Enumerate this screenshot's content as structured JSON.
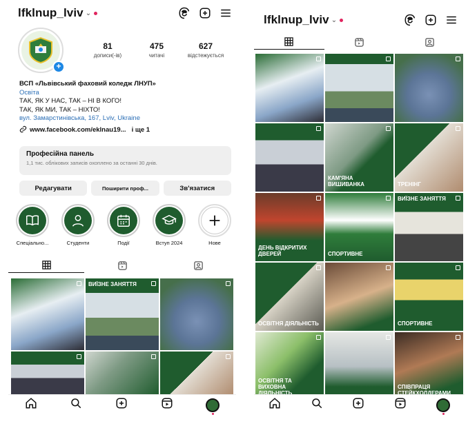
{
  "left": {
    "username": "lfklnup_lviv",
    "stats": [
      {
        "num": "81",
        "label": "дописи(-ів)"
      },
      {
        "num": "475",
        "label": "читачі"
      },
      {
        "num": "627",
        "label": "відстежується"
      }
    ],
    "bio": {
      "name": "ВСП «Львівський фаховий коледж ЛНУП»",
      "category": "Освіта",
      "line1": "ТАК, ЯК У НАС, ТАК – НІ В КОГО!",
      "line2": "ТАК, ЯК МИ, ТАК – НІХТО!",
      "address": "вул. Замарстинівська, 167, Lviv, Ukraine",
      "link": "www.facebook.com/eklnau19...",
      "link_more": "і ще 1"
    },
    "panel": {
      "title": "Професійна панель",
      "subtitle": "1,1 тис. облікових записів охоплено за останні 30 днів."
    },
    "buttons": {
      "edit": "Редагувати",
      "share": "Поширити проф...",
      "contact": "Зв'язатися"
    },
    "highlights": [
      {
        "label": "Спеціально..."
      },
      {
        "label": "Студенти"
      },
      {
        "label": "Події"
      },
      {
        "label": "Вступ 2024"
      },
      {
        "label": "Нове"
      }
    ],
    "grid_captions": [
      "",
      "ВИЇЗНЕ ЗАНЯТТЯ",
      "",
      "",
      "",
      ""
    ]
  },
  "right": {
    "username": "lfklnup_lviv",
    "grid_captions": [
      "",
      "",
      "",
      "",
      "КАМ'ЯНА ВИШИВАНКА",
      "ТРЕНІНГ",
      "ДЕНЬ ВІДКРИТИХ ДВЕРЕЙ",
      "СПОРТИВНЕ",
      "ВИЇЗНЕ ЗАНЯТТЯ",
      "ОСВІТНЯ ДІЯЛЬНІСТЬ",
      "",
      "СПОРТИВНЕ",
      "ОСВІТНЯ ТА ВИХОВНА ДІЯЛЬНІСТЬ",
      "",
      "СПІВПРАЦЯ СТЕЙКХОЛДЕРАМИ"
    ]
  },
  "colors": {
    "brand_green": "#1f5c2e",
    "link_blue": "#2c6fb6",
    "badge_blue": "#1e88e5",
    "notif_red": "#e0245e"
  },
  "icons": [
    "threads-icon",
    "add-post-icon",
    "menu-icon",
    "grid-icon",
    "reels-icon",
    "tagged-icon",
    "home-icon",
    "search-icon",
    "create-icon",
    "reels-nav-icon",
    "profile-avatar"
  ]
}
